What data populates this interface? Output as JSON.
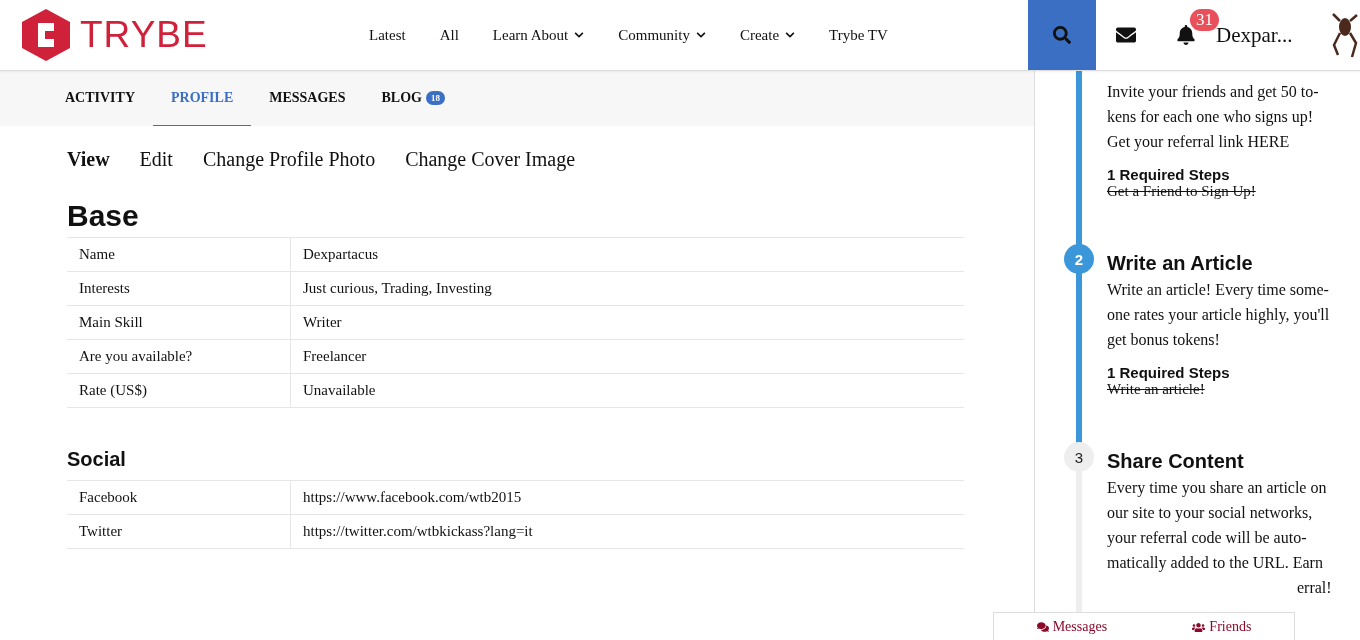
{
  "header": {
    "logo": "TRYBE",
    "nav": [
      {
        "label": "Latest",
        "dropdown": false
      },
      {
        "label": "All",
        "dropdown": false
      },
      {
        "label": "Learn About",
        "dropdown": true
      },
      {
        "label": "Community",
        "dropdown": true
      },
      {
        "label": "Create",
        "dropdown": true
      },
      {
        "label": "Trybe TV",
        "dropdown": false
      }
    ],
    "notification_count": "31",
    "username": "Dexpar..."
  },
  "tabs": [
    {
      "label": "ACTIVITY",
      "selected": false
    },
    {
      "label": "PROFILE",
      "selected": true
    },
    {
      "label": "MESSAGES",
      "selected": false
    },
    {
      "label": "BLOG",
      "selected": false,
      "badge": "18"
    }
  ],
  "subnav": [
    {
      "label": "View",
      "selected": true
    },
    {
      "label": "Edit",
      "selected": false
    },
    {
      "label": "Change Profile Photo",
      "selected": false
    },
    {
      "label": "Change Cover Image",
      "selected": false
    }
  ],
  "sections": [
    {
      "title": "Base",
      "kind": "major",
      "rows": [
        {
          "label": "Name",
          "value": "Dexpartacus"
        },
        {
          "label": "Interests",
          "value": "Just curious, Trading, Investing"
        },
        {
          "label": "Main Skill",
          "value": "Writer"
        },
        {
          "label": "Are you available?",
          "value": "Freelancer"
        },
        {
          "label": "Rate (US$)",
          "value": "Unavailable"
        }
      ]
    },
    {
      "title": "Social",
      "kind": "minor",
      "rows": [
        {
          "label": "Facebook",
          "value": "https://www.facebook.com/wtb2015"
        },
        {
          "label": "Twitter",
          "value": "https://twitter.com/wtbkickass?lang=it"
        }
      ]
    }
  ],
  "steps": [
    {
      "completed": true,
      "lines": [
        "Invite your friends and get 50 to-",
        "kens for each one who signs up!",
        "Get your referral link HERE"
      ],
      "required": "1 Required Steps",
      "task": "Get a Friend to Sign Up!",
      "task_done": true
    },
    {
      "number": "2",
      "title": "Write an Article",
      "completed": true,
      "lines": [
        "Write an article! Every time some-",
        "one rates your article highly, you'll",
        "get bonus tokens!"
      ],
      "required": "1 Required Steps",
      "task": "Write an article!",
      "task_done": true
    },
    {
      "number": "3",
      "title": "Share Content",
      "completed": false,
      "lines": [
        "Every time you share an article on",
        "our site to your social networks,",
        "your referral code will be auto-",
        "matically added to the URL. Earn"
      ],
      "covered_tail": "erral!"
    }
  ],
  "chat_bar": [
    {
      "label": "Messages"
    },
    {
      "label": "Friends"
    }
  ]
}
